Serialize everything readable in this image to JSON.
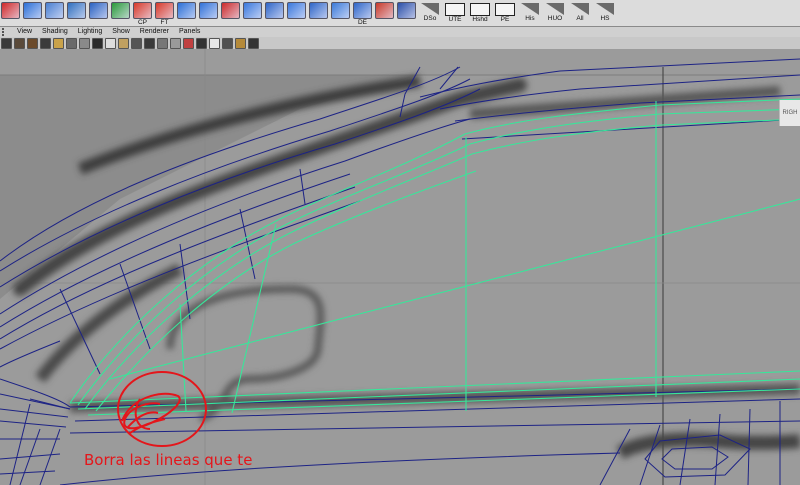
{
  "shelf": {
    "tools": [
      {
        "id": "curve",
        "label": "",
        "color": "#d02828"
      },
      {
        "id": "cube",
        "label": "",
        "color": "#2b6fd6"
      },
      {
        "id": "scene",
        "label": "",
        "color": "#4a7fd0"
      },
      {
        "id": "cylinder",
        "label": "",
        "color": "#2f6fbf"
      },
      {
        "id": "split",
        "label": "",
        "color": "#2a62c2"
      },
      {
        "id": "sphere",
        "label": "",
        "color": "#2a9a3a"
      },
      {
        "id": "cp",
        "label": "CP",
        "color": "#d83a2a"
      },
      {
        "id": "ft",
        "label": "FT",
        "color": "#d83a2a"
      },
      {
        "id": "plane",
        "label": "",
        "color": "#2b6fd6"
      },
      {
        "id": "grid1",
        "label": "",
        "color": "#3272d8"
      },
      {
        "id": "delete",
        "label": "",
        "color": "#cc2a2a"
      },
      {
        "id": "grid2",
        "label": "",
        "color": "#3a78dc"
      },
      {
        "id": "grid3",
        "label": "",
        "color": "#2f66c8"
      },
      {
        "id": "grid4",
        "label": "",
        "color": "#3a78dc"
      },
      {
        "id": "grid5",
        "label": "",
        "color": "#2f66c8"
      },
      {
        "id": "grid6",
        "label": "",
        "color": "#3b7ad8"
      },
      {
        "id": "de",
        "label": "DE",
        "color": "#2f66c8"
      },
      {
        "id": "nodes",
        "label": "",
        "color": "#c83a2a"
      },
      {
        "id": "sphere2",
        "label": "",
        "color": "#2a4fa8"
      }
    ],
    "text_tools": [
      {
        "label": "DSo",
        "kind": "ramp"
      },
      {
        "label": "UTE",
        "kind": "box"
      },
      {
        "label": "Hshd",
        "kind": "box"
      },
      {
        "label": "PE",
        "kind": "box"
      },
      {
        "label": "His",
        "kind": "ramp"
      },
      {
        "label": "HUO",
        "kind": "ramp"
      },
      {
        "label": "All",
        "kind": "ramp"
      },
      {
        "label": "HS",
        "kind": "ramp"
      }
    ]
  },
  "menu": {
    "items": [
      "View",
      "Shading",
      "Lighting",
      "Show",
      "Renderer",
      "Panels"
    ]
  },
  "panel_icons": [
    "#3a3a3a",
    "#5a4a3a",
    "#6b4a2a",
    "#3b3b3b",
    "#c9a24a",
    "#6a6a6a",
    "#8a8a8a",
    "#2a2a2a",
    "#ddd",
    "#c0a060",
    "#555",
    "#3a3a3a",
    "#777",
    "#9a9a9a",
    "#c04040",
    "#333",
    "#e8e8e8",
    "#505050",
    "#b58a3a",
    "#333"
  ],
  "viewport": {
    "camera_label": "RIGH"
  },
  "annotation": {
    "text": "Borra las lineas que te",
    "color": "#e4161b"
  },
  "colors": {
    "wire": "#1d2385",
    "selected": "#38e69a",
    "background": "#9a9a9a"
  }
}
